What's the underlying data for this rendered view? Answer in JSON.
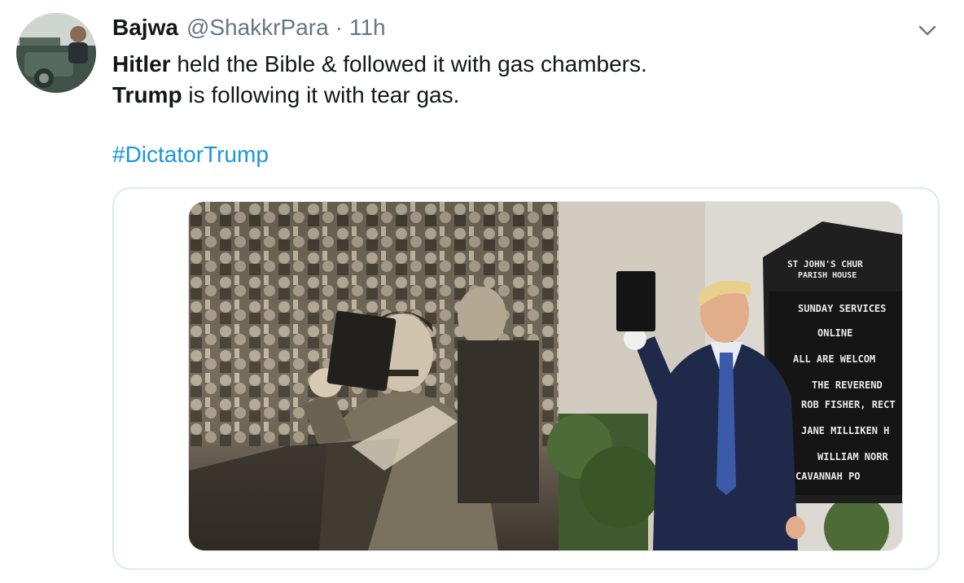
{
  "tweet": {
    "author_name": "Bajwa",
    "handle": "@ShakkrPara",
    "separator": "·",
    "timestamp": "11h",
    "line1_bold": "Hitler",
    "line1_rest": " held the Bible & followed it with gas chambers.",
    "line2_bold": "Trump",
    "line2_rest": " is following it with tear gas.",
    "hashtag": "#DictatorTrump"
  },
  "media": {
    "sign_lines": [
      "ST JOHN'S CHUR",
      "PARISH HOUSE",
      "SUNDAY SERVICES",
      "ONLINE",
      "ALL ARE WELCOM",
      "THE REVEREND",
      "ROB FISHER, RECT",
      "JANE MILLIKEN H",
      "WILLIAM NORR",
      "CAVANNAH PO"
    ]
  },
  "icons": {
    "menu": "chevron-down-icon"
  },
  "colors": {
    "link": "#1b95e0",
    "secondary": "#657786",
    "border": "#e1e8ed"
  }
}
